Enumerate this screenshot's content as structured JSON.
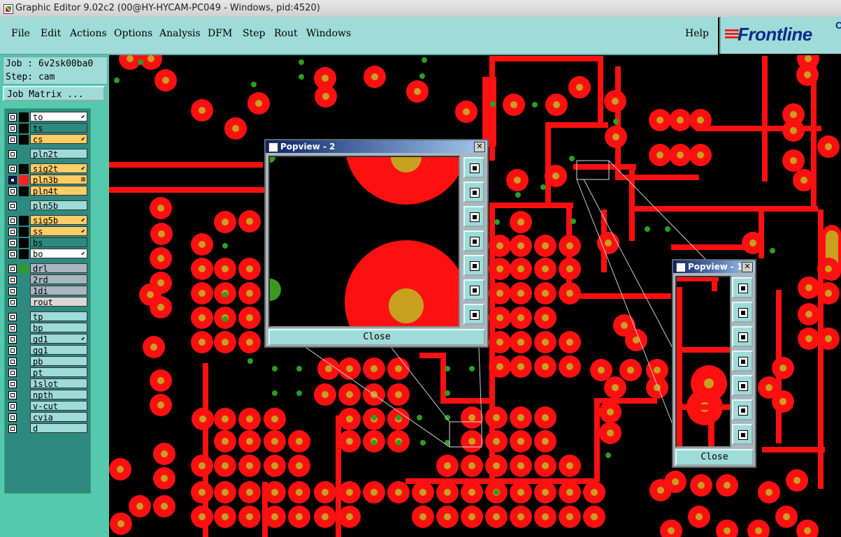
{
  "window": {
    "title": "Graphic Editor 9.02c2 (00@HY-HYCAM-PC049 - Windows, pid:4520)"
  },
  "menu": {
    "items": [
      "File",
      "Edit",
      "Actions",
      "Options",
      "Analysis",
      "DFM",
      "Step",
      "Rout",
      "Windows"
    ],
    "help": "Help"
  },
  "logo": {
    "text": "Frontline",
    "suffix": "C"
  },
  "job": {
    "job_label": "Job : 6v2sk00ba0",
    "step_label": "Step: cam",
    "matrix_button": "Job Matrix ..."
  },
  "layers": [
    {
      "name": "to",
      "color": "#ffffff",
      "sw": "#000000",
      "arrow": "⬋"
    },
    {
      "name": "ts",
      "color": "#2e8a80",
      "sw": "#000000",
      "arrow": ""
    },
    {
      "name": "cs",
      "color": "#ffcc66",
      "sw": "#000000",
      "arrow": "⬋"
    },
    {
      "name": "pln2t",
      "color": "#9fdbd8",
      "sw": "#2e8a80",
      "arrow": ""
    },
    {
      "name": "sig2t",
      "color": "#ffcc66",
      "sw": "#000000",
      "arrow": "⬋"
    },
    {
      "name": "pln3b",
      "color": "#ffcc66",
      "sw": "#ff2020",
      "arrow": "⊞",
      "active": true
    },
    {
      "name": "pln4t",
      "color": "#ffcc66",
      "sw": "#000000",
      "arrow": ""
    },
    {
      "name": "pln5b",
      "color": "#9fdbd8",
      "sw": "#2e8a80",
      "arrow": ""
    },
    {
      "name": "sig5b",
      "color": "#ffcc66",
      "sw": "#000000",
      "arrow": "⬋"
    },
    {
      "name": "ss",
      "color": "#ffcc66",
      "sw": "#000000",
      "arrow": "⬋"
    },
    {
      "name": "bs",
      "color": "#2e8a80",
      "sw": "#000000",
      "arrow": ""
    },
    {
      "name": "bo",
      "color": "#ffffff",
      "sw": "#000000",
      "arrow": "⬋"
    },
    {
      "name": "drl",
      "color": "#a9b6bd",
      "sw": "#2e9a30",
      "arrow": ""
    },
    {
      "name": "2rd",
      "color": "#a9b6bd",
      "sw": "#2e8a80",
      "arrow": ""
    },
    {
      "name": "1di",
      "color": "#a9b6bd",
      "sw": "#2e8a80",
      "arrow": ""
    },
    {
      "name": "rout",
      "color": "#d8d8d8",
      "sw": "#2e8a80",
      "arrow": ""
    },
    {
      "name": "tp",
      "color": "#9fdbd8",
      "sw": "#2e8a80",
      "arrow": ""
    },
    {
      "name": "bp",
      "color": "#9fdbd8",
      "sw": "#2e8a80",
      "arrow": ""
    },
    {
      "name": "gd1",
      "color": "#9fdbd8",
      "sw": "#2e8a80",
      "arrow": "⬋"
    },
    {
      "name": "gg1",
      "color": "#9fdbd8",
      "sw": "#2e8a80",
      "arrow": ""
    },
    {
      "name": "pb",
      "color": "#9fdbd8",
      "sw": "#2e8a80",
      "arrow": ""
    },
    {
      "name": "pt",
      "color": "#9fdbd8",
      "sw": "#2e8a80",
      "arrow": ""
    },
    {
      "name": "1slot",
      "color": "#9fdbd8",
      "sw": "#2e8a80",
      "arrow": ""
    },
    {
      "name": "npth",
      "color": "#9fdbd8",
      "sw": "#2e8a80",
      "arrow": ""
    },
    {
      "name": "v-cut",
      "color": "#9fdbd8",
      "sw": "#2e8a80",
      "arrow": ""
    },
    {
      "name": "cvia",
      "color": "#9fdbd8",
      "sw": "#2e8a80",
      "arrow": ""
    },
    {
      "name": "d",
      "color": "#9fdbd8",
      "sw": "#2e8a80",
      "arrow": ""
    }
  ],
  "popview2": {
    "title": "Popview - 2",
    "close_label": "Close"
  },
  "popview1": {
    "title": "Popview - 1",
    "close_label": "Close"
  },
  "colors": {
    "pad": "#ff1010",
    "drill": "#c8a020",
    "via": "#2aa020",
    "menu_bg": "#9fdbd8",
    "sidebar_bg": "#55c9ae"
  }
}
